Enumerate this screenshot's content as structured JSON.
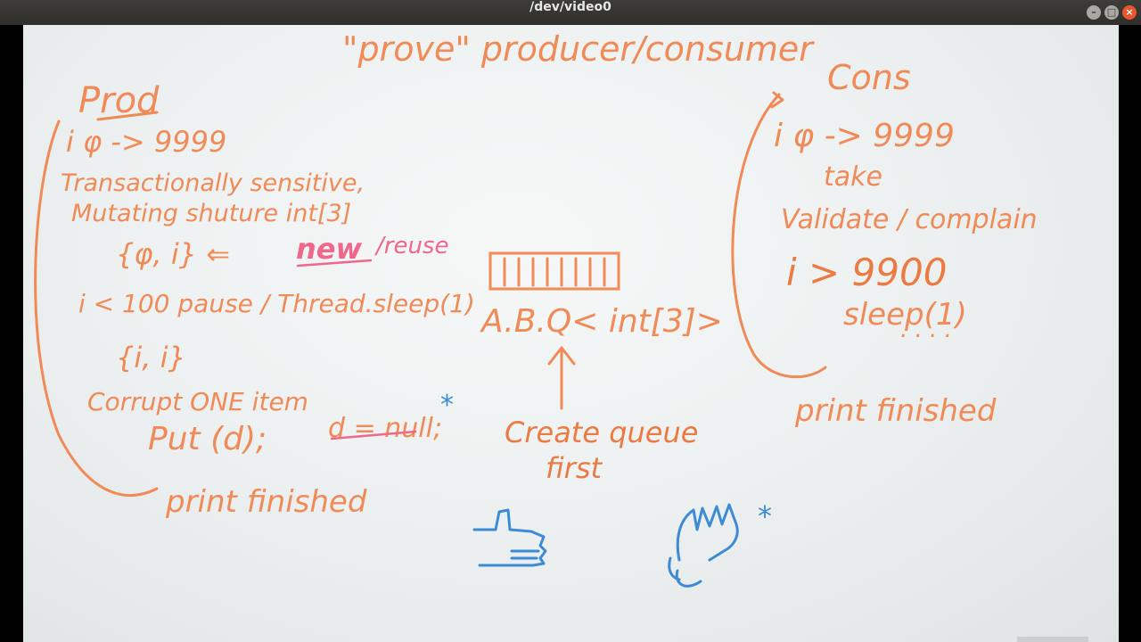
{
  "window": {
    "title": "/dev/video0",
    "min_glyph": "–",
    "max_glyph": "□",
    "close_glyph": "×"
  },
  "board": {
    "heading": "\"prove\" producer/consumer",
    "prod": {
      "title": "Prod",
      "lines": [
        "i φ -> 9999",
        "Transactionally sensitive,",
        "Mutating shuture  int[3]",
        "{φ, i} ⇐",
        "i < 100  pause / Thread.sleep(1)",
        "{i, i}",
        "Corrupt ONE item",
        "Put (d); ",
        "print finished"
      ],
      "new_word": "new",
      "reuse_word": "/reuse",
      "null_word": "d = null;"
    },
    "queue": {
      "label": "A.B.Q< int[3]>",
      "note_line1": "Create queue",
      "note_line2": "first"
    },
    "cons": {
      "title": "Cons",
      "lines": [
        "i φ -> 9999",
        "take",
        "Validate / complain",
        "i > 9900",
        "sleep(1)",
        ". . . .",
        "print finished"
      ]
    },
    "star": "*",
    "colors": {
      "orange": "#f08a57",
      "pink": "#f0678c",
      "blue": "#3d8bd6"
    }
  }
}
